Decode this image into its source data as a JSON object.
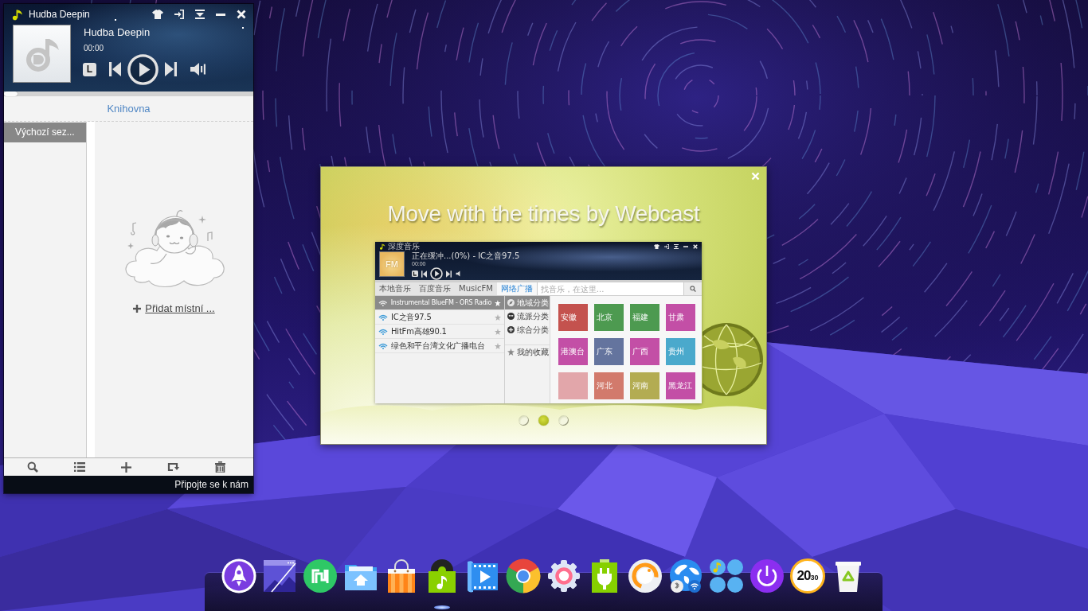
{
  "player": {
    "title": "Hudba Deepin",
    "track_title": "Hudba Deepin",
    "time": "00:00",
    "lyrics_button": "L",
    "progress": {
      "level": 0
    },
    "library_title": "Knihovna",
    "playlists": [
      {
        "label": "Výchozí sez...",
        "selected": true
      }
    ],
    "add_local": "Přidat místní ...",
    "footer_link": "Připojte se k nám"
  },
  "promo": {
    "title": "Move with the times by Webcast",
    "screenshot": {
      "title": "深度音乐",
      "now_playing": "正在缓冲...(0%) - IC之音97.5",
      "time": "00:00",
      "art_label": "FM",
      "tabs": [
        {
          "label": "本地音乐",
          "selected": false
        },
        {
          "label": "百度音乐",
          "selected": false
        },
        {
          "label": "MusicFM",
          "selected": false
        },
        {
          "label": "网络广播",
          "selected": true
        }
      ],
      "search": {
        "placeholder": "找音乐，在这里..."
      },
      "stations": [
        {
          "name": "Instrumental BlueFM - ORS Radio",
          "selected": true
        },
        {
          "name": "IC之音97.5",
          "selected": false
        },
        {
          "name": "HitFm高雄90.1",
          "selected": false
        },
        {
          "name": "绿色和平台湾文化广播电台",
          "selected": false
        }
      ],
      "categories": [
        {
          "label": "地域分类",
          "selected": true
        },
        {
          "label": "流派分类",
          "selected": false
        },
        {
          "label": "综合分类",
          "selected": false
        },
        {
          "label": "我的收藏",
          "selected": false
        }
      ],
      "regions": [
        {
          "label": "安徽",
          "color": "#c4524e"
        },
        {
          "label": "北京",
          "color": "#4d9a50"
        },
        {
          "label": "福建",
          "color": "#4d9a50"
        },
        {
          "label": "甘肃",
          "color": "#c34fa6"
        },
        {
          "label": "港澳台",
          "color": "#c34fa6"
        },
        {
          "label": "广东",
          "color": "#64749e"
        },
        {
          "label": "广西",
          "color": "#c34fa6"
        },
        {
          "label": "贵州",
          "color": "#4aa9cc"
        },
        {
          "color": "#e2a6aa"
        },
        {
          "label": "河北",
          "color": "#d27a6c"
        },
        {
          "label": "河南",
          "color": "#b3ac52"
        },
        {
          "label": "黑龙江",
          "color": "#c34fa6"
        }
      ]
    },
    "pages": [
      {
        "selected": false
      },
      {
        "selected": true
      },
      {
        "selected": false
      }
    ]
  },
  "dock": {
    "items": [
      {
        "kind": "rocket",
        "running": false
      },
      {
        "kind": "window",
        "running": false
      },
      {
        "kind": "app",
        "running": false
      },
      {
        "kind": "folder",
        "running": false
      },
      {
        "kind": "bag",
        "running": false
      },
      {
        "kind": "music",
        "running": true
      },
      {
        "kind": "video",
        "running": false
      },
      {
        "kind": "browser",
        "running": false
      },
      {
        "kind": "gear",
        "running": false
      },
      {
        "kind": "battery",
        "running": false
      },
      {
        "kind": "dial",
        "running": false
      },
      {
        "kind": "globe",
        "running": false
      },
      {
        "kind": "grid",
        "running": false
      },
      {
        "kind": "power",
        "running": false
      },
      {
        "kind": "clock",
        "hours": "20",
        "minutes": "30",
        "running": false
      },
      {
        "kind": "trash",
        "running": false
      }
    ]
  }
}
